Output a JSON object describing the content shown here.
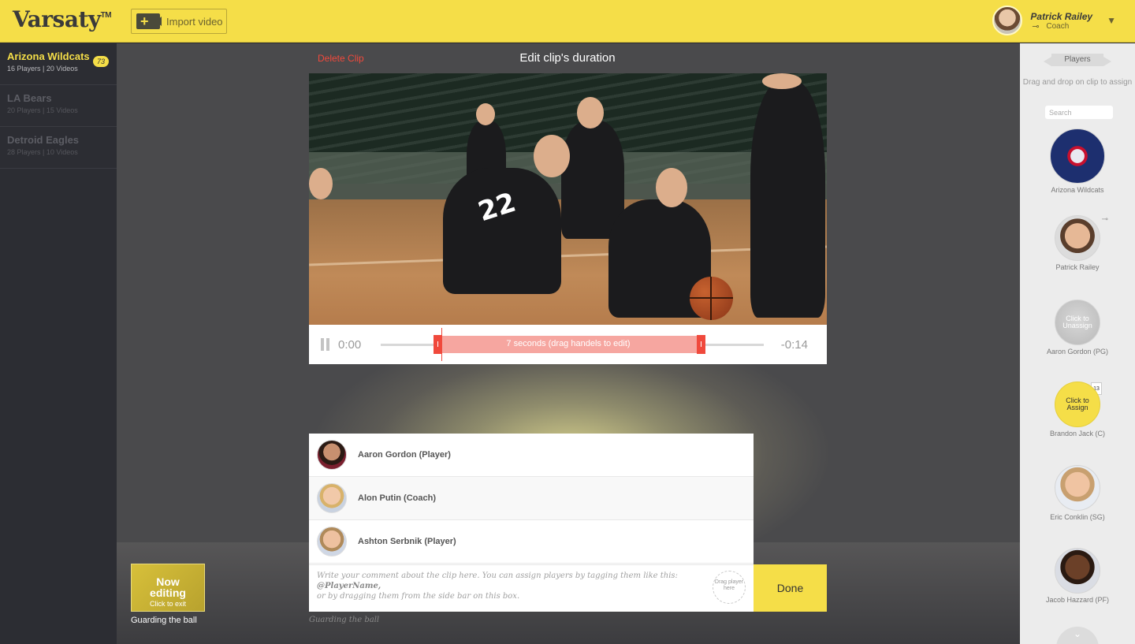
{
  "header": {
    "logo": "Varsaty",
    "logo_tm": "TM",
    "import_label": "Import video",
    "import_icon": "+",
    "user_name": "Patrick Railey",
    "user_role": "Coach",
    "chevron": "▼"
  },
  "teams": [
    {
      "name": "Arizona Wildcats",
      "meta": "16 Players  |  20 Videos",
      "badge": "73"
    },
    {
      "name": "LA Bears",
      "meta": "20 Players  |  15 Videos"
    },
    {
      "name": "Detroid Eagles",
      "meta": "28 Players  |  10 Videos"
    }
  ],
  "editor": {
    "delete_label": "Delete Clip",
    "title": "Edit clip's duration",
    "time_start": "0:00",
    "time_end": "-0:14",
    "clip_label": "7 seconds (drag handels to edit)",
    "jersey_number": "22"
  },
  "tags": [
    {
      "name": "Aaron Gordon (Player)"
    },
    {
      "name": "Alon Putin (Coach)"
    },
    {
      "name": "Ashton Serbnik (Player)"
    }
  ],
  "comment": {
    "placeholder_main": "Write your comment about the clip here. You can assign players by tagging them like this:",
    "placeholder_tag": "@PlayerName,",
    "placeholder_tail": "or by dragging them from the side bar on this box.",
    "drop_hint": "Drag player here",
    "done_label": "Done",
    "caption": "Guarding the ball"
  },
  "now_editing": {
    "title_line1": "Now",
    "title_line2": "editing",
    "subtitle": "Click to exit",
    "caption": "Guarding the ball"
  },
  "roster": {
    "tab_label": "Players",
    "hint": "Drag and drop on clip to assign",
    "search_placeholder": "Search",
    "items": [
      {
        "label": "Arizona Wildcats"
      },
      {
        "label": "Patrick Railey"
      },
      {
        "label": "Aaron Gordon (PG)",
        "overlay": "Click to Unassign"
      },
      {
        "label": "Brandon Jack (C)",
        "overlay": "Click to Assign",
        "number": "13"
      },
      {
        "label": "Eric Conklin (SG)"
      },
      {
        "label": "Jacob Hazzard (PF)"
      }
    ]
  },
  "colors": {
    "brand_yellow": "#f5de48",
    "accent_red": "#f0493c",
    "sidebar_dark": "#2c2d33"
  }
}
